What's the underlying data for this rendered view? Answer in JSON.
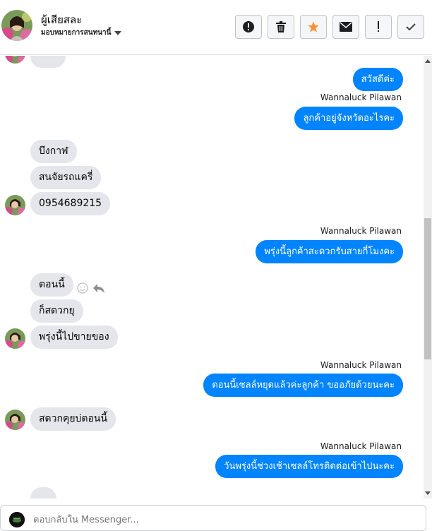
{
  "header": {
    "contact_name": "ผู้เสียสละ",
    "assign_label": "มอบหมายการสนทนานี้",
    "toolbar": [
      {
        "name": "report-spam-button",
        "icon": "alert-circle-icon"
      },
      {
        "name": "delete-button",
        "icon": "trash-icon"
      },
      {
        "name": "star-button",
        "icon": "star-icon"
      },
      {
        "name": "mark-unread-button",
        "icon": "envelope-icon"
      },
      {
        "name": "flag-button",
        "icon": "exclamation-icon"
      },
      {
        "name": "mark-done-button",
        "icon": "checkmark-icon"
      }
    ]
  },
  "messages": {
    "m1": "สวัสดีค่ะ",
    "sender1": "Wannaluck Pilawan",
    "m2": "ลูกค้าอยู่จังหวัดอะไรคะ",
    "m3": "บึงกาฬ",
    "m4": "สนจัยรถแครี่",
    "m5": "0954689215",
    "sender2": "Wannaluck Pilawan",
    "m6": "พรุ่งนี้ลูกค้าสะดวกรับสายกี่โมงคะ",
    "m7": "ตอนนี้",
    "m8": "ก็สดวกยุ",
    "m9": "พรุ่งนี้ไปขายของ",
    "sender3": "Wannaluck Pilawan",
    "m10": "ตอนนี้เซลล์หยุดแล้วค่ะลูกค้า ขออภัยด้วยนะคะ",
    "m11": "สดวกคุยบ่ตอนนี้",
    "sender4": "Wannaluck Pilawan",
    "m12": "วันพรุ่งนี้ช่วงเช้าเซลล์โทรติดต่อเข้าไปนะคะ"
  },
  "composer": {
    "placeholder": "ตอบกลับใน Messenger..."
  },
  "colors": {
    "outgoing_bubble": "#0084ff",
    "incoming_bubble": "#e4e6eb",
    "star": "#f7923b"
  }
}
